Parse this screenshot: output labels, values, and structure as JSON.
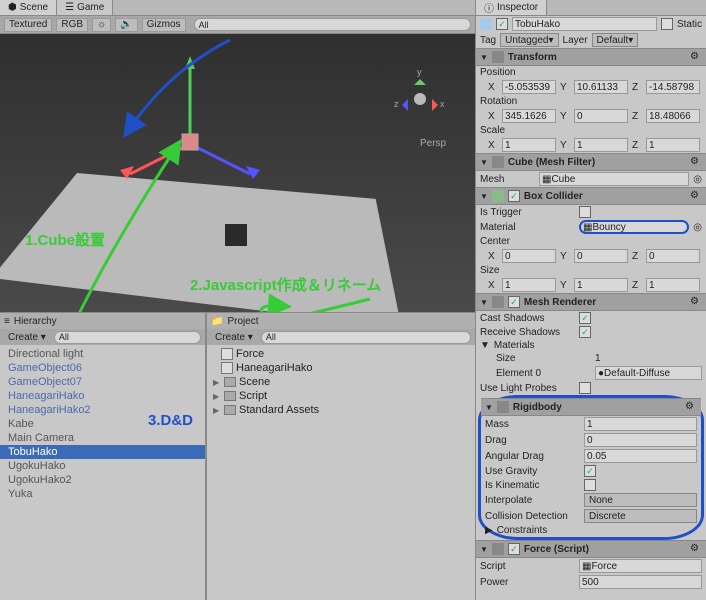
{
  "tabs": {
    "scene": "Scene",
    "game": "Game",
    "inspector": "Inspector"
  },
  "scene_toolbar": {
    "shading": "Textured",
    "render": "RGB",
    "gizmos": "Gizmos",
    "search_placeholder": "All",
    "persp": "Persp"
  },
  "annotations": {
    "a1": "1.Cube設置",
    "a2": "2.Javascript作成＆リネーム",
    "a3": "3.D&D"
  },
  "hierarchy": {
    "title": "Hierarchy",
    "create": "Create",
    "items": [
      {
        "label": "Directional light",
        "blue": false
      },
      {
        "label": "GameObject06",
        "blue": true
      },
      {
        "label": "GameObject07",
        "blue": true
      },
      {
        "label": "HaneagariHako",
        "blue": true
      },
      {
        "label": "HaneagariHako2",
        "blue": true
      },
      {
        "label": "Kabe",
        "blue": false
      },
      {
        "label": "Main Camera",
        "blue": false
      },
      {
        "label": "TobuHako",
        "blue": false,
        "selected": true
      },
      {
        "label": "UgokuHako",
        "blue": false
      },
      {
        "label": "UgokuHako2",
        "blue": false
      },
      {
        "label": "Yuka",
        "blue": false
      }
    ]
  },
  "project": {
    "title": "Project",
    "create": "Create",
    "force": "Force",
    "haneagari": "HaneagariHako",
    "folders": [
      "Scene",
      "Script",
      "Standard Assets"
    ]
  },
  "inspector": {
    "name": "TobuHako",
    "static": "Static",
    "tag_label": "Tag",
    "tag_value": "Untagged",
    "layer_label": "Layer",
    "layer_value": "Default",
    "transform": {
      "title": "Transform",
      "position_label": "Position",
      "position": {
        "x": "-5.053539",
        "y": "10.61133",
        "z": "-14.58798"
      },
      "rotation_label": "Rotation",
      "rotation": {
        "x": "345.1626",
        "y": "0",
        "z": "18.48066"
      },
      "scale_label": "Scale",
      "scale": {
        "x": "1",
        "y": "1",
        "z": "1"
      }
    },
    "mesh_filter": {
      "title": "Cube (Mesh Filter)",
      "mesh_label": "Mesh",
      "mesh": "Cube"
    },
    "box_collider": {
      "title": "Box Collider",
      "is_trigger": "Is Trigger",
      "material": "Material",
      "material_value": "Bouncy",
      "center": "Center",
      "center_v": {
        "x": "0",
        "y": "0",
        "z": "0"
      },
      "size": "Size",
      "size_v": {
        "x": "1",
        "y": "1",
        "z": "1"
      }
    },
    "mesh_renderer": {
      "title": "Mesh Renderer",
      "cast": "Cast Shadows",
      "receive": "Receive Shadows",
      "materials": "Materials",
      "size_label": "Size",
      "size": "1",
      "element0": "Element 0",
      "element0_val": "Default-Diffuse",
      "light_probes": "Use Light Probes"
    },
    "rigidbody": {
      "title": "Rigidbody",
      "mass": "Mass",
      "mass_v": "1",
      "drag": "Drag",
      "drag_v": "0",
      "angular": "Angular Drag",
      "angular_v": "0.05",
      "gravity": "Use Gravity",
      "kinematic": "Is Kinematic",
      "interpolate": "Interpolate",
      "interpolate_v": "None",
      "collision": "Collision Detection",
      "collision_v": "Discrete",
      "constraints": "Constraints"
    },
    "force_script": {
      "title": "Force (Script)",
      "script": "Script",
      "script_v": "Force",
      "power": "Power",
      "power_v": "500"
    }
  }
}
